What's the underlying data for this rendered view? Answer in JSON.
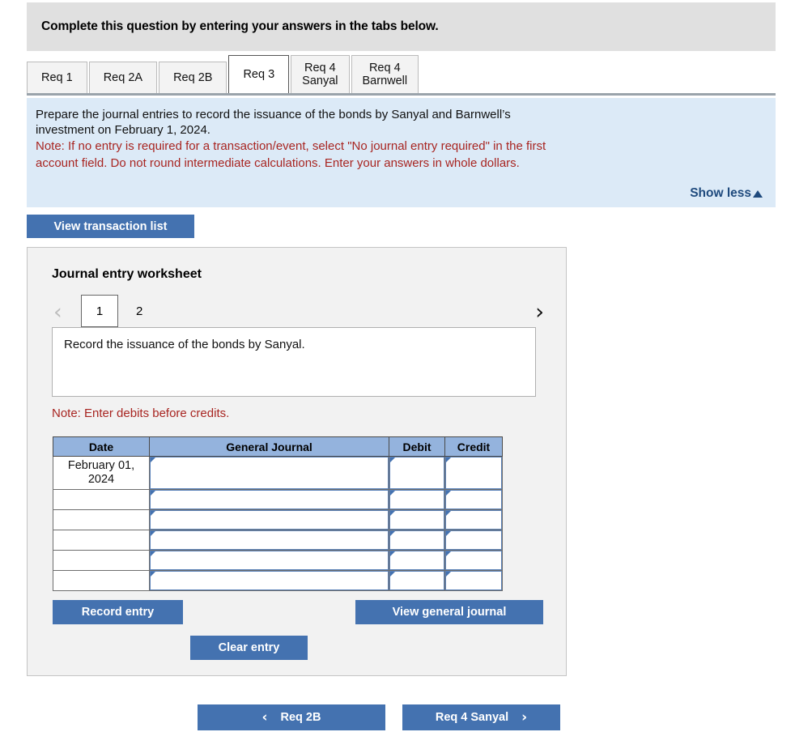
{
  "banner": {
    "text": "Complete this question by entering your answers in the tabs below."
  },
  "tabs": [
    {
      "label": "Req 1",
      "lines": [
        "Req 1"
      ],
      "active": false
    },
    {
      "label": "Req 2A",
      "lines": [
        "Req 2A"
      ],
      "active": false
    },
    {
      "label": "Req 2B",
      "lines": [
        "Req 2B"
      ],
      "active": false
    },
    {
      "label": "Req 3",
      "lines": [
        "Req 3"
      ],
      "active": true
    },
    {
      "label": "Req 4 Sanyal",
      "lines": [
        "Req 4",
        "Sanyal"
      ],
      "active": false
    },
    {
      "label": "Req 4 Barnwell",
      "lines": [
        "Req 4",
        "Barnwell"
      ],
      "active": false
    }
  ],
  "instructions": {
    "line1": "Prepare the journal entries to record the issuance of the bonds by Sanyal and Barnwell’s",
    "line2": "investment on February 1, 2024.",
    "note1": "Note: If no entry is required for a transaction/event, select \"No journal entry required\" in the first",
    "note2": "account field. Do not round intermediate calculations. Enter your answers in whole dollars.",
    "show_less_label": "Show less"
  },
  "toolbar": {
    "view_transaction_list_label": "View transaction list"
  },
  "worksheet": {
    "title": "Journal entry worksheet",
    "pager": {
      "prev_icon": "‹",
      "next_icon": "›",
      "pages": [
        "1",
        "2"
      ],
      "active_page": "1"
    },
    "description": "Record the issuance of the bonds by Sanyal.",
    "note": "Note: Enter debits before credits.",
    "table": {
      "headers": [
        "Date",
        "General Journal",
        "Debit",
        "Credit"
      ],
      "rows": [
        {
          "date": "February 01, 2024",
          "general_journal": "",
          "debit": "",
          "credit": ""
        },
        {
          "date": "",
          "general_journal": "",
          "debit": "",
          "credit": ""
        },
        {
          "date": "",
          "general_journal": "",
          "debit": "",
          "credit": ""
        },
        {
          "date": "",
          "general_journal": "",
          "debit": "",
          "credit": ""
        },
        {
          "date": "",
          "general_journal": "",
          "debit": "",
          "credit": ""
        },
        {
          "date": "",
          "general_journal": "",
          "debit": "",
          "credit": ""
        }
      ]
    },
    "buttons": {
      "record_entry": "Record entry",
      "clear_entry": "Clear entry",
      "view_general_journal": "View general journal"
    }
  },
  "footer_nav": {
    "prev_label": "Req 2B",
    "next_label": "Req 4 Sanyal",
    "prev_icon": "‹",
    "next_icon": "›"
  },
  "colors": {
    "accent_blue": "#4472b0",
    "banner_gray": "#e0e0e0",
    "instruction_blue": "#dceaf7",
    "note_red": "#a82521",
    "link_navy": "#1f4a7d",
    "table_header_blue": "#94b3dd"
  }
}
